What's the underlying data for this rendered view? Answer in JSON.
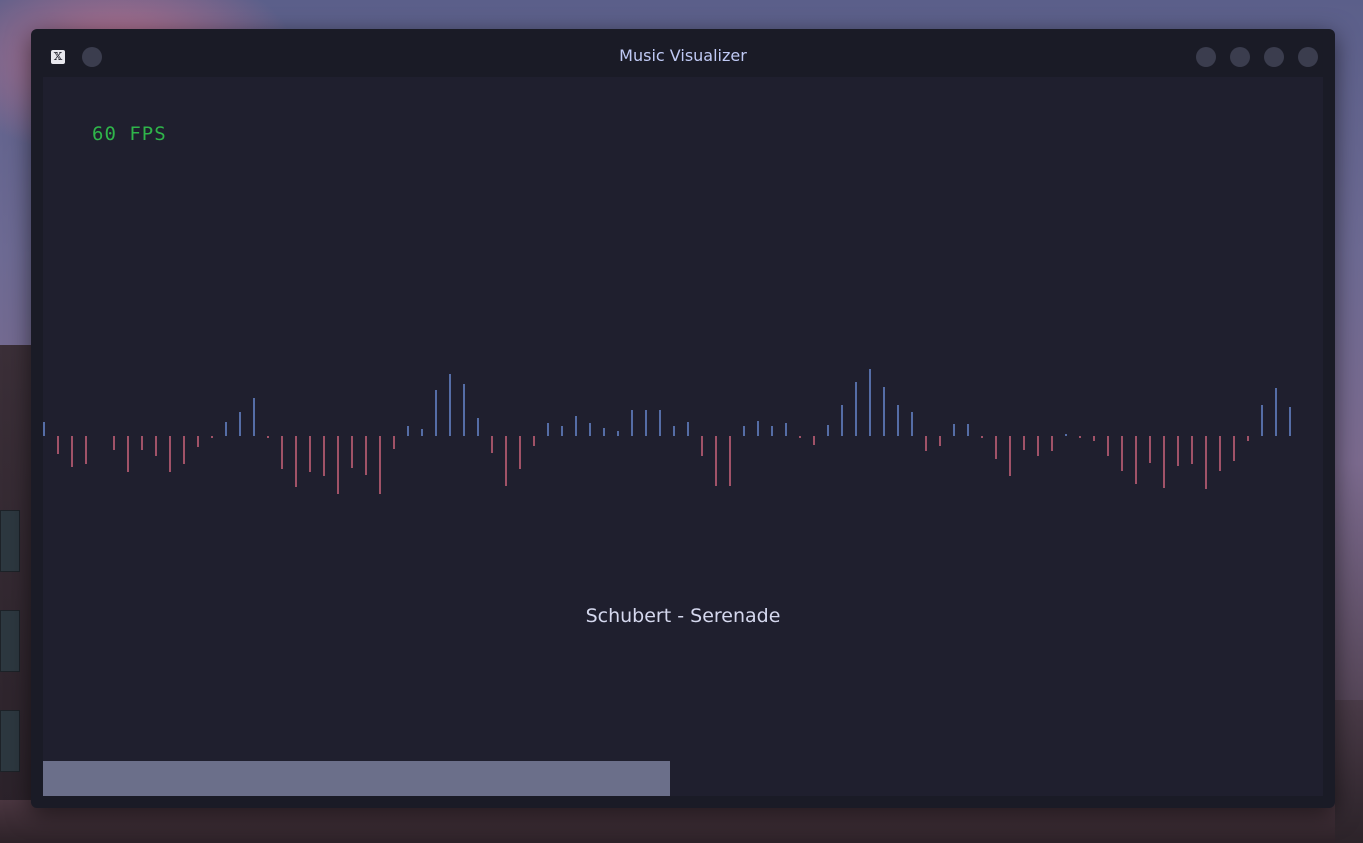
{
  "window": {
    "title": "Music Visualizer",
    "app_icon": "x-logo-icon"
  },
  "visualizer": {
    "fps_label": "60 FPS",
    "song_title": "Schubert - Serenade",
    "progress_fraction": 0.49,
    "colors": {
      "background": "#1f1f2e",
      "positive_bar": "#7aa2f7",
      "negative_bar": "#f7768e",
      "fps_text": "#2fb54a",
      "progress_fill": "#6b6f8a"
    },
    "bar_amplitudes": [
      14,
      -18,
      -31,
      -28,
      0,
      -14,
      -36,
      -14,
      -20,
      -36,
      -28,
      -11,
      -2,
      14,
      24,
      38,
      -2,
      -33,
      -51,
      -36,
      -40,
      -58,
      -32,
      -39,
      -58,
      -13,
      10,
      7,
      46,
      62,
      52,
      18,
      -17,
      -50,
      -33,
      -10,
      13,
      10,
      20,
      13,
      8,
      5,
      26,
      26,
      26,
      10,
      14,
      -20,
      -50,
      -50,
      10,
      15,
      10,
      13,
      -2,
      -9,
      11,
      31,
      54,
      67,
      49,
      31,
      24,
      -15,
      -10,
      12,
      12,
      -2,
      -23,
      -40,
      -14,
      -20,
      -15,
      2,
      -2,
      -5,
      -20,
      -35,
      -48,
      -27,
      -52,
      -30,
      -28,
      -53,
      -35,
      -25,
      -5,
      31,
      48,
      29
    ]
  }
}
